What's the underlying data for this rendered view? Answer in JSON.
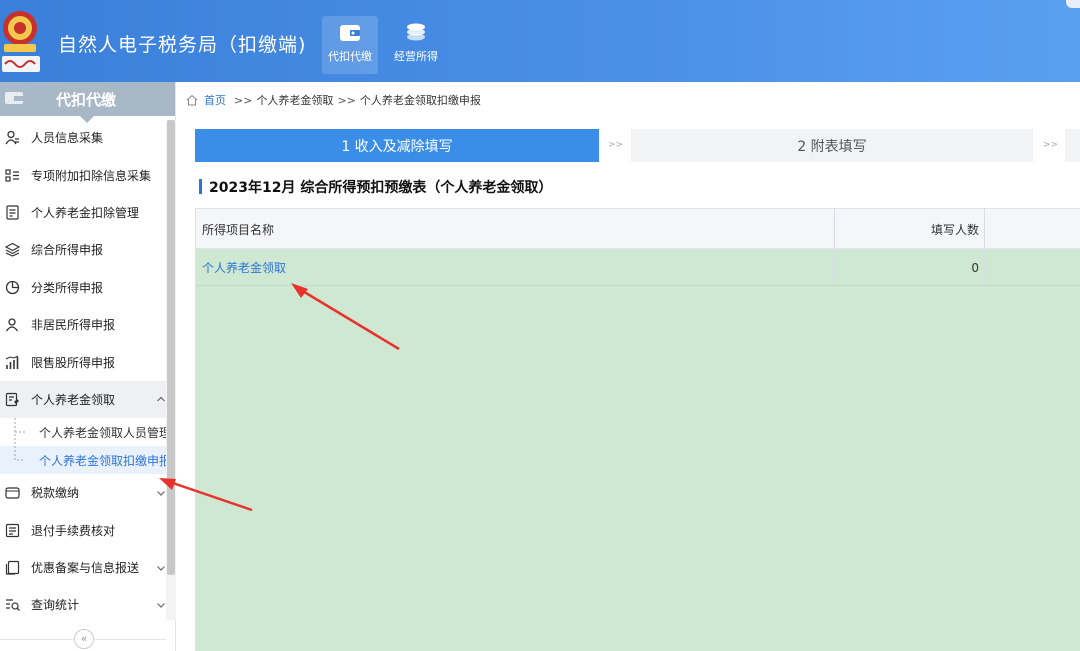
{
  "header": {
    "app_title": "自然人电子税务局（扣缴端)",
    "tabs": [
      {
        "label": "代扣代缴",
        "icon": "wallet-icon",
        "active": true
      },
      {
        "label": "经营所得",
        "icon": "coins-icon",
        "active": false
      }
    ],
    "accent_color": "#3a7fd9"
  },
  "sidebar": {
    "title": "代扣代缴",
    "items": [
      {
        "label": "人员信息采集",
        "icon": "person-icon",
        "expandable": false
      },
      {
        "label": "专项附加扣除信息采集",
        "icon": "list-icon",
        "expandable": false
      },
      {
        "label": "个人养老金扣除管理",
        "icon": "doc-icon",
        "expandable": false
      },
      {
        "label": "综合所得申报",
        "icon": "layers-icon",
        "expandable": false
      },
      {
        "label": "分类所得申报",
        "icon": "pie-icon",
        "expandable": false
      },
      {
        "label": "非居民所得申报",
        "icon": "user-icon",
        "expandable": false
      },
      {
        "label": "限售股所得申报",
        "icon": "bar-chart-icon",
        "expandable": false
      },
      {
        "label": "个人养老金领取",
        "icon": "pension-icon",
        "expandable": true,
        "open": true,
        "children": [
          {
            "label": "个人养老金领取人员管理",
            "active": false
          },
          {
            "label": "个人养老金领取扣缴申报",
            "active": true
          }
        ]
      },
      {
        "label": "税款缴纳",
        "icon": "wallet-small-icon",
        "expandable": true
      },
      {
        "label": "退付手续费核对",
        "icon": "receipt-icon",
        "expandable": false
      },
      {
        "label": "优惠备案与信息报送",
        "icon": "copy-icon",
        "expandable": true
      },
      {
        "label": "查询统计",
        "icon": "search-list-icon",
        "expandable": true
      }
    ],
    "collapse_glyph": "«"
  },
  "breadcrumb": {
    "home": "首页",
    "sep": ">>",
    "items": [
      "个人养老金领取",
      "个人养老金领取扣缴申报"
    ]
  },
  "steps": [
    {
      "label": "1 收入及减除填写",
      "active": true
    },
    {
      "label": "2 附表填写",
      "active": false
    }
  ],
  "step_sep": ">>",
  "section_title": "2023年12月  综合所得预扣预缴表（个人养老金领取）",
  "table": {
    "columns": [
      "所得项目名称",
      "填写人数"
    ],
    "rows": [
      {
        "name": "个人养老金领取",
        "count": "0"
      }
    ],
    "body_color": "#cfe8d2"
  }
}
